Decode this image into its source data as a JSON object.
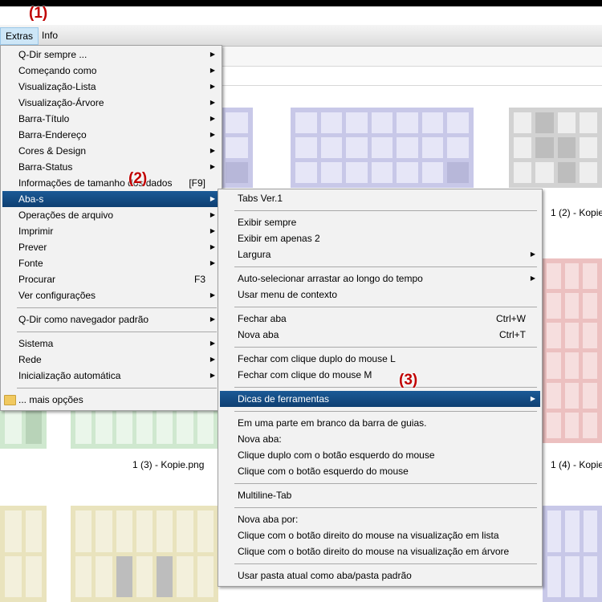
{
  "annotations": {
    "a1": "(1)",
    "a2": "(2)",
    "a3": "(3)"
  },
  "menubar": {
    "extras": "Extras",
    "info": "Info"
  },
  "thumbnails": {
    "label_top_right": "1 (2) - Kopie",
    "label_mid": "1 (3) - Kopie.png",
    "label_mid_right": "1 (4) - Kopie"
  },
  "extras_menu": {
    "items": [
      "Q-Dir sempre ...",
      "Começando como",
      "Visualização-Lista",
      "Visualização-Árvore",
      "Barra-Título",
      "Barra-Endereço",
      "Cores & Design",
      "Barra-Status",
      "Informações de tamanho dos dados",
      "Aba-s",
      "Operações de arquivo",
      "Imprimir",
      "Prever",
      "Fonte",
      "Procurar",
      "Ver configurações",
      "Q-Dir como navegador padrão",
      "Sistema",
      "Rede",
      "Inicialização automática",
      "... mais opções"
    ],
    "shortcuts": {
      "info_size": "[F9]",
      "search": "F3"
    }
  },
  "tabs_menu": {
    "items": [
      "Tabs Ver.1",
      "Exibir sempre",
      "Exibir em apenas 2",
      "Largura",
      "Auto-selecionar arrastar ao longo do tempo",
      "Usar menu de contexto",
      "Fechar aba",
      "Nova aba",
      "Fechar com clique duplo do mouse L",
      "Fechar com clique do mouse M",
      "Dicas de ferramentas",
      "Em uma parte em branco da barra de guias.",
      "Nova aba:",
      "Clique duplo com o botão esquerdo do mouse",
      "Clique com o botão esquerdo do mouse",
      "Multiline-Tab",
      "Nova aba por:",
      "Clique com o botão direito do mouse na visualização em lista",
      "Clique com o botão direito do mouse na visualização em árvore",
      "Usar pasta atual como aba/pasta padrão"
    ],
    "shortcuts": {
      "close_tab": "Ctrl+W",
      "new_tab": "Ctrl+T"
    }
  },
  "colors": {
    "highlight": "#0e3f72",
    "annotation": "#c00000"
  }
}
